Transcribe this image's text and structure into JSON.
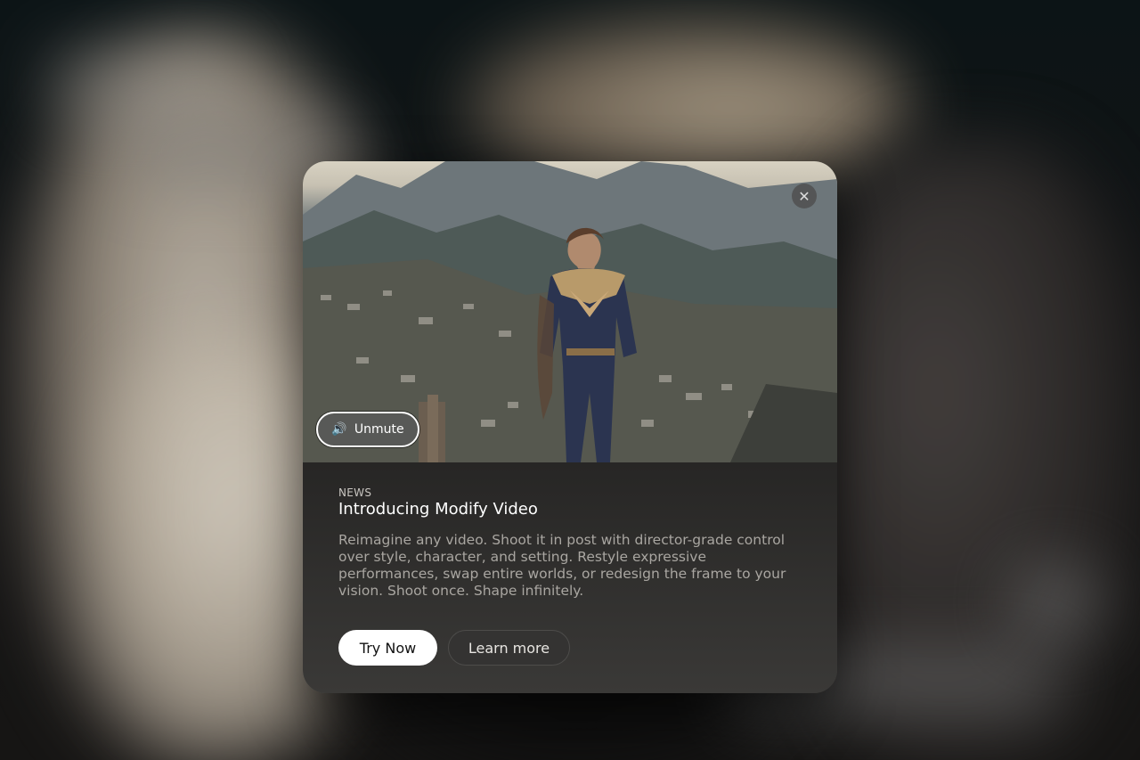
{
  "modal": {
    "close_icon": "close-icon",
    "unmute": {
      "icon": "speaker-icon",
      "glyph": "🔊",
      "label": "Unmute"
    },
    "eyebrow": "NEWS",
    "title": "Introducing Modify Video",
    "description": "Reimagine any video. Shoot it in post with director-grade control over style, character, and setting. Restyle expressive performances, swap entire worlds, or redesign the frame to your vision. Shoot once. Shape infinitely.",
    "buttons": {
      "primary": "Try Now",
      "secondary": "Learn more"
    }
  },
  "colors": {
    "backdrop": "#0a0d0e",
    "modal_bg": "#262524",
    "primary_btn": "#ffffff",
    "secondary_btn": "#343332"
  }
}
